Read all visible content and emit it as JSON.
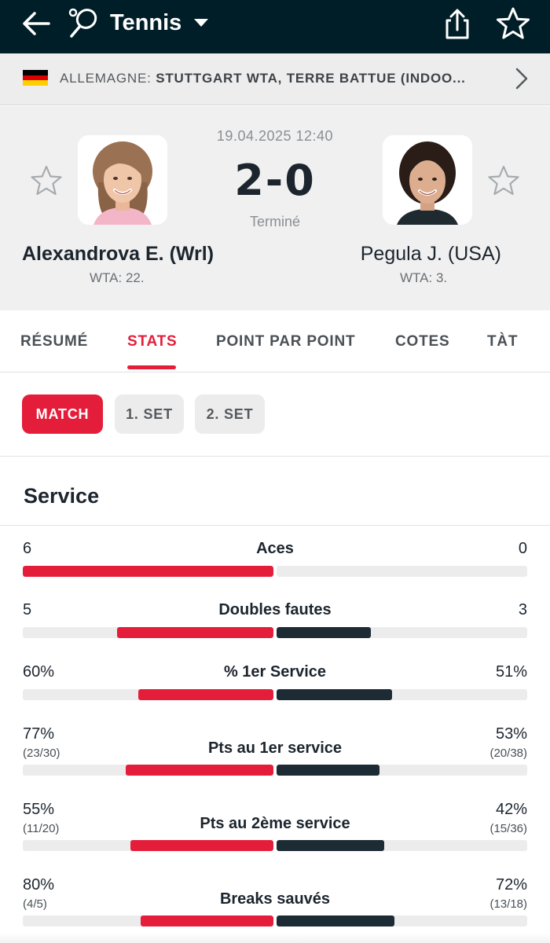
{
  "topbar": {
    "title": "Tennis",
    "icons": [
      "back-arrow-icon",
      "tennis-racket-icon",
      "caret-down-icon",
      "share-icon",
      "star-icon"
    ]
  },
  "tournament": {
    "country": "ALLEMAGNE:",
    "event": "STUTTGART WTA, TERRE BATTUE (INDOO...",
    "flag_colors": [
      "#000000",
      "#dd0000",
      "#ffce00"
    ]
  },
  "match": {
    "datetime": "19.04.2025 12:40",
    "score": "2-0",
    "status": "Terminé",
    "home": {
      "name": "Alexandrova E. (Wrl)",
      "rank": "WTA: 22."
    },
    "away": {
      "name": "Pegula J. (USA)",
      "rank": "WTA: 3."
    }
  },
  "tabs": [
    {
      "label": "RÉSUMÉ",
      "active": false
    },
    {
      "label": "STATS",
      "active": true
    },
    {
      "label": "POINT PAR POINT",
      "active": false
    },
    {
      "label": "COTES",
      "active": false
    },
    {
      "label": "TÀT",
      "active": false
    }
  ],
  "subtabs": [
    {
      "label": "MATCH",
      "active": true
    },
    {
      "label": "1. SET",
      "active": false
    },
    {
      "label": "2. SET",
      "active": false
    }
  ],
  "section": {
    "title": "Service"
  },
  "stats": [
    {
      "name": "Aces",
      "home": "6",
      "away": "0",
      "home_sub": "",
      "away_sub": "",
      "home_share": 1.0,
      "away_share": 0.0
    },
    {
      "name": "Doubles fautes",
      "home": "5",
      "away": "3",
      "home_sub": "",
      "away_sub": "",
      "home_share": 0.625,
      "away_share": 0.375
    },
    {
      "name": "% 1er Service",
      "home": "60%",
      "away": "51%",
      "home_sub": "",
      "away_sub": "",
      "home_share": 0.54,
      "away_share": 0.46
    },
    {
      "name": "Pts au 1er service",
      "home": "77%",
      "away": "53%",
      "home_sub": "(23/30)",
      "away_sub": "(20/38)",
      "home_share": 0.59,
      "away_share": 0.41
    },
    {
      "name": "Pts au 2ème service",
      "home": "55%",
      "away": "42%",
      "home_sub": "(11/20)",
      "away_sub": "(15/36)",
      "home_share": 0.57,
      "away_share": 0.43
    },
    {
      "name": "Breaks sauvés",
      "home": "80%",
      "away": "72%",
      "home_sub": "(4/5)",
      "away_sub": "(13/18)",
      "home_share": 0.53,
      "away_share": 0.47
    }
  ],
  "colors": {
    "accent": "#e41e3a",
    "dark": "#001e28",
    "away_bar": "#1c2b34"
  }
}
